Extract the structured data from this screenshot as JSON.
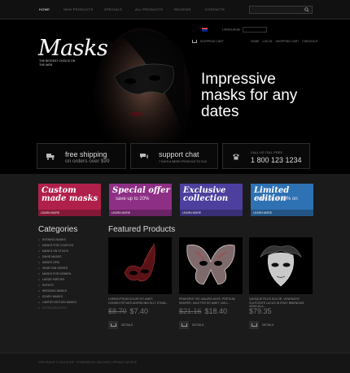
{
  "nav": {
    "items": [
      "HOME",
      "NEW PRODUCTS",
      "SPECIALS",
      "ALL PRODUCTS",
      "REVIEWS",
      "CONTACTS"
    ]
  },
  "header": {
    "logo": "Masks",
    "tagline": "THE BIGGEST CHOICE ON THE WEB",
    "language_label": "LANGUAGE",
    "currency_label": "US DOLLAR",
    "cart_label": "SHOPPING CART",
    "account_links": [
      "HOME",
      "LOG IN",
      "SHOPPING CART",
      "CHECKOUT"
    ],
    "headline": "Impressive masks for any dates"
  },
  "features": [
    {
      "icon": "truck-icon",
      "title": "free shipping",
      "subtitle": "on orders over $99"
    },
    {
      "icon": "chat-icon",
      "title": "support chat",
      "subtitle": "7 DAYS A WEEK FROM 9:00 TO 5:00"
    },
    {
      "icon": "phone-icon",
      "title": "CALL US TOLL FREE",
      "subtitle": "1 800 123 1234"
    }
  ],
  "banners": [
    {
      "title": "Custom made masks",
      "subtitle": "",
      "more": "LEARN MORE",
      "color": "#b0204a"
    },
    {
      "title": "Special offer",
      "subtitle": "save up to 20%",
      "more": "LEARN MORE",
      "color": "#8e2f86"
    },
    {
      "title": "Exclusive collection",
      "subtitle": "",
      "more": "LEARN MORE",
      "color": "#4c3f9e"
    },
    {
      "title": "Limited edition",
      "subtitle": "save up to 30% on",
      "more": "LEARN MORE",
      "color": "#2e72b3"
    }
  ],
  "categories": {
    "title": "Categories",
    "items": [
      "EVENING MASKS",
      "MASKS FOR COUPLES",
      "MASKS ON STICKS",
      "DAVID MASKS",
      "MASKS OPAI",
      "VENETIAN SERIES",
      "MASKS FOR WOMEN",
      "LARGE PARTIES",
      "EVENTS",
      "WEDDING MASKS",
      "SCARY MASKS",
      "LIMITED EDITION MASKS",
      "EXTRA DELIGHTS"
    ]
  },
  "featured": {
    "title": "Featured Products",
    "products": [
      {
        "desc": "LOREM IPSUM DOLOR SIT AMET, CONSECTETUER ADIPISCING ELIT. ETIAM...",
        "old_price": "$8.70",
        "price": "$7.40",
        "details": "DETAILS"
      },
      {
        "desc": "PRAESENT VEL MAURIS ANTE. PRETIUM SEMPER, SAGITTIS SIT AMET, NULL...",
        "old_price": "$21.16",
        "price": "$18.40",
        "details": "DETAILS"
      },
      {
        "desc": "QUISQUE FELIS DOLOR, VENENATIS VULPUTATE LACUS IN ERAT, BIBENDUM VEHICULA...",
        "old_price": "",
        "price": "$79.35",
        "details": "DETAILS"
      }
    ]
  },
  "footer": {
    "text": "COPYRIGHT © 2013 SHOP - POWERED BY ZEN CART | PRIVACY NOTICE"
  }
}
